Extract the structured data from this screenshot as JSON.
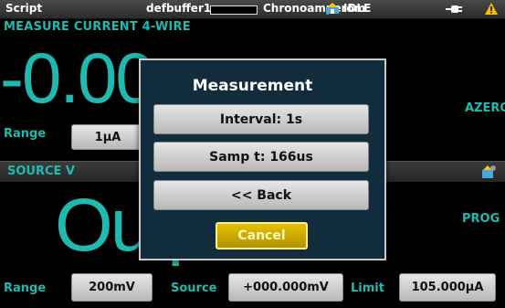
{
  "status_bar": {
    "mode": "Script",
    "buffer": "defbuffer1",
    "function": "Chronoamperom",
    "state": "IDLE",
    "icons": [
      "config-icon",
      "plug-icon",
      "warning-icon"
    ]
  },
  "measure": {
    "header": "MEASURE CURRENT 4-WIRE",
    "reading": "-0.00",
    "range_label": "Range",
    "range_value": "1μA",
    "azero_label": "AZERO"
  },
  "source": {
    "header": "SOURCE V",
    "output_text": "Output",
    "prog_label": "PROG"
  },
  "bottom": {
    "range_label": "Range",
    "range_value": "200mV",
    "source_label": "Source",
    "source_value": "+000.000mV",
    "limit_label": "Limit",
    "limit_value": "105.000μA"
  },
  "dialog": {
    "title": "Measurement",
    "interval": "Interval: 1s",
    "samp": "Samp t: 166us",
    "back": "<< Back",
    "cancel": "Cancel"
  },
  "colors": {
    "accent": "#1fb9b0",
    "dialog_bg": "#102c3d",
    "cancel": "#e4c100",
    "warning": "#f5c400"
  }
}
